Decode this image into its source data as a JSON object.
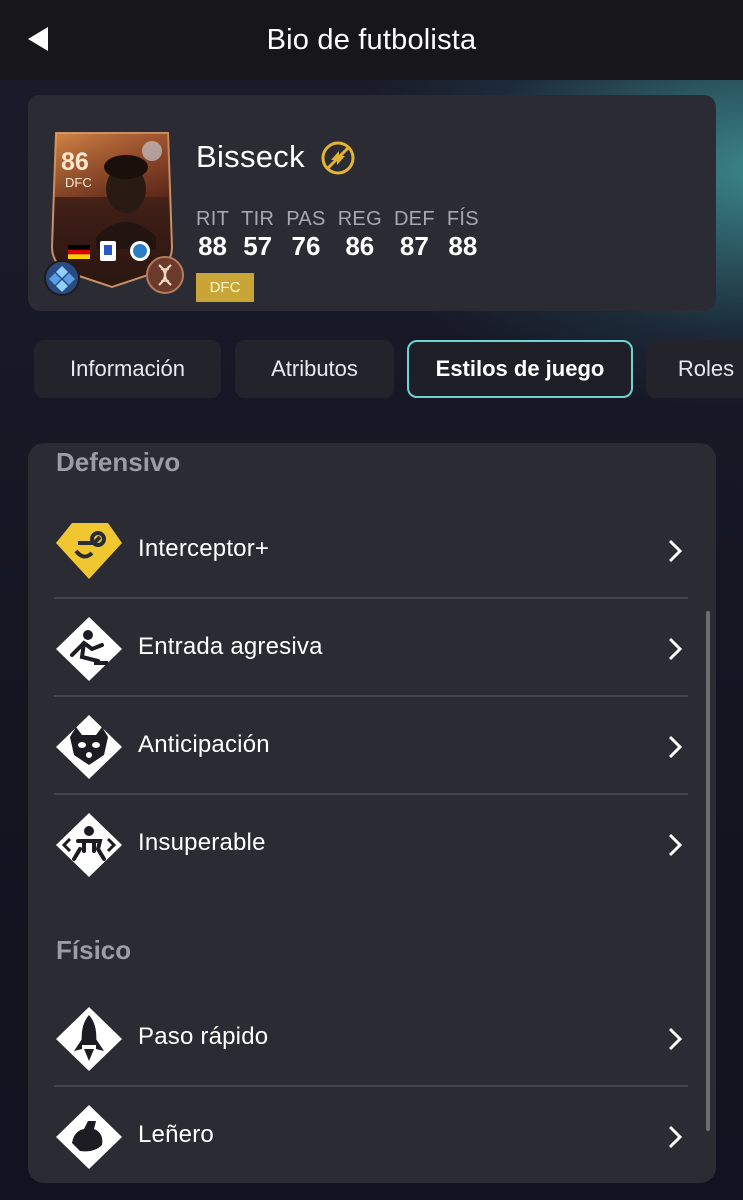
{
  "header": {
    "title": "Bio de futbolista"
  },
  "player": {
    "name": "Bisseck",
    "rating": "86",
    "position": "DFC",
    "position_badge": "DFC",
    "stats": [
      {
        "label": "RIT",
        "value": "88"
      },
      {
        "label": "TIR",
        "value": "57"
      },
      {
        "label": "PAS",
        "value": "76"
      },
      {
        "label": "REG",
        "value": "86"
      },
      {
        "label": "DEF",
        "value": "87"
      },
      {
        "label": "FÍS",
        "value": "88"
      }
    ]
  },
  "tabs": [
    {
      "label": "Información",
      "active": false
    },
    {
      "label": "Atributos",
      "active": false
    },
    {
      "label": "Estilos de juego",
      "active": true
    },
    {
      "label": "Roles",
      "active": false
    }
  ],
  "sections": [
    {
      "title": "Defensivo",
      "items": [
        {
          "label": "Interceptor+",
          "icon": "interceptor-plus-icon"
        },
        {
          "label": "Entrada agresiva",
          "icon": "aggressive-tackle-icon"
        },
        {
          "label": "Anticipación",
          "icon": "anticipate-raccoon-icon"
        },
        {
          "label": "Insuperable",
          "icon": "insuperable-icon"
        }
      ]
    },
    {
      "title": "Físico",
      "items": [
        {
          "label": "Paso rápido",
          "icon": "quick-step-rocket-icon"
        },
        {
          "label": "Leñero",
          "icon": "bruiser-arm-icon"
        }
      ]
    }
  ],
  "colors": {
    "accent": "#6fd3d0",
    "gold": "#e3b431",
    "badge": "#c9a537",
    "panel": "#2b2b33"
  }
}
